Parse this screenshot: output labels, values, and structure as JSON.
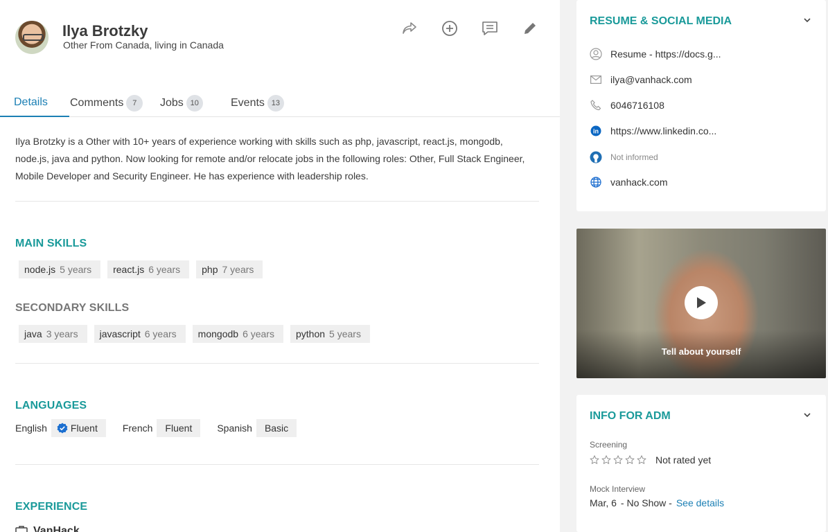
{
  "profile": {
    "name": "Ilya Brotzky",
    "subtitle": "Other From Canada, living in Canada"
  },
  "actions": [
    "share-icon",
    "add-circle-icon",
    "comment-icon",
    "edit-pencil-icon"
  ],
  "tabs": [
    {
      "label": "Details",
      "count": ""
    },
    {
      "label": "Comments",
      "count": "7"
    },
    {
      "label": "Jobs",
      "count": "10"
    },
    {
      "label": "Events",
      "count": "13"
    }
  ],
  "summary": "Ilya Brotzky is a Other with 10+ years of experience working with skills such as php, javascript, react.js, mongodb, node.js, java and python. Now looking for remote and/or relocate jobs in the following roles: Other, Full Stack Engineer, Mobile Developer and Security Engineer. He has experience with leadership roles.",
  "main_skills": {
    "title": "MAIN SKILLS",
    "items": [
      {
        "name": "node.js",
        "years": "5 years"
      },
      {
        "name": "react.js",
        "years": "6 years"
      },
      {
        "name": "php",
        "years": "7 years"
      }
    ]
  },
  "secondary_skills": {
    "title": "SECONDARY SKILLS",
    "items": [
      {
        "name": "java",
        "years": "3 years"
      },
      {
        "name": "javascript",
        "years": "6 years"
      },
      {
        "name": "mongodb",
        "years": "6 years"
      },
      {
        "name": "python",
        "years": "5 years"
      }
    ]
  },
  "languages": {
    "title": "LANGUAGES",
    "items": [
      {
        "name": "English",
        "level": "Fluent",
        "verified": true
      },
      {
        "name": "French",
        "level": "Fluent",
        "verified": false
      },
      {
        "name": "Spanish",
        "level": "Basic",
        "verified": false
      }
    ]
  },
  "experience": {
    "title": "EXPERIENCE",
    "first_company": "VanHack"
  },
  "resume_card": {
    "title": "RESUME & SOCIAL MEDIA",
    "items": [
      {
        "icon": "user-circle-icon",
        "text": "Resume - https://docs.g..."
      },
      {
        "icon": "mail-icon",
        "text": "ilya@vanhack.com"
      },
      {
        "icon": "phone-icon",
        "text": "6046716108"
      },
      {
        "icon": "linkedin-icon",
        "text": "https://www.linkedin.co..."
      },
      {
        "icon": "github-icon",
        "text": "Not informed"
      },
      {
        "icon": "globe-icon",
        "text": "vanhack.com"
      }
    ]
  },
  "video": {
    "caption": "Tell about yourself"
  },
  "adm_card": {
    "title": "INFO FOR ADM",
    "screening_label": "Screening",
    "screening_value": "Not rated yet",
    "rating": 0,
    "mock_label": "Mock Interview",
    "mock_date": "Mar, 6",
    "mock_status": "- No Show -",
    "mock_link": "See details"
  },
  "colors": {
    "accent_teal": "#1a9a9a",
    "link_blue": "#1b7fb4"
  }
}
